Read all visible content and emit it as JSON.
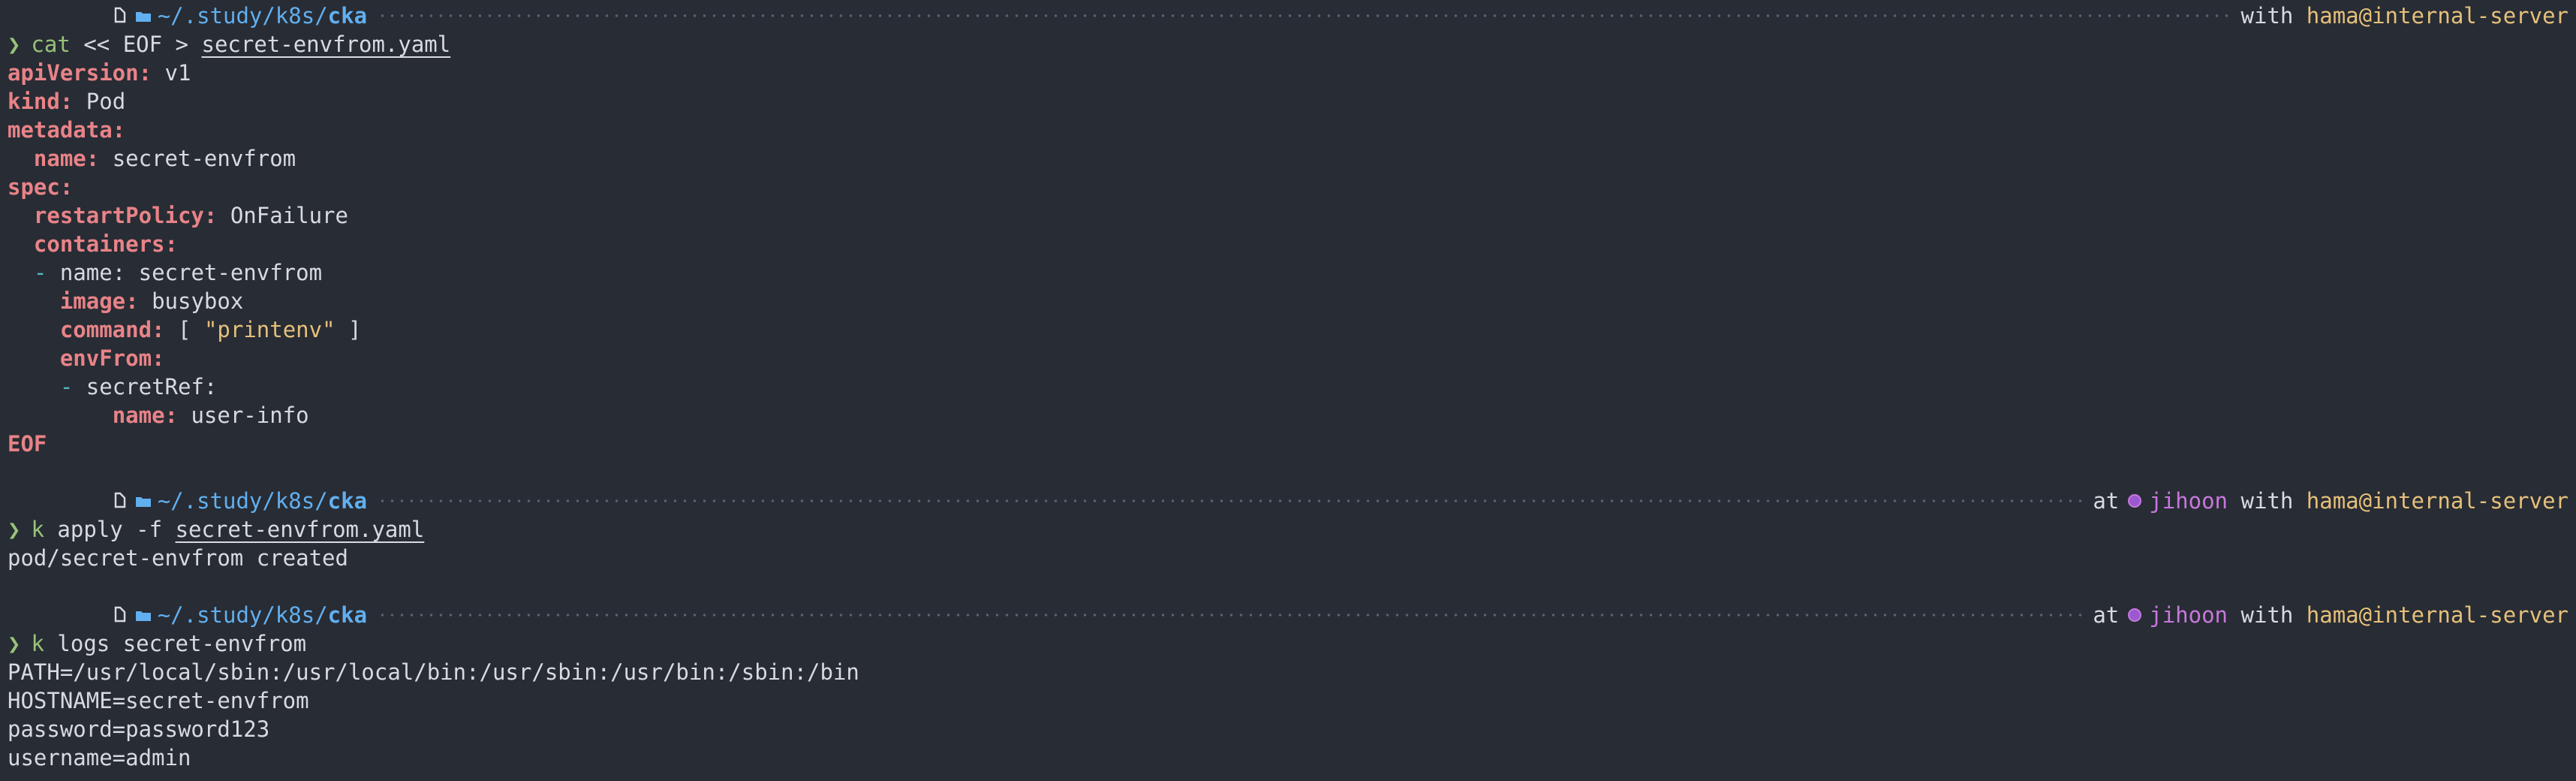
{
  "prompt": {
    "apple_icon": "apple-icon",
    "folder_icon": "folder-icon",
    "path_prefix": "~/.study/k8s/",
    "path_dir": "cka",
    "at_label": "at",
    "k8s_context": "jihoon",
    "with_label": "with",
    "user_host": "hama@internal-server",
    "chevron": "❯"
  },
  "block1": {
    "command_verb": "cat",
    "command_heredoc": "<< EOF >",
    "command_file": "secret-envfrom.yaml",
    "yaml": {
      "apiVersion_key": "apiVersion:",
      "apiVersion_val": "v1",
      "kind_key": "kind:",
      "kind_val": "Pod",
      "metadata_key": "metadata:",
      "name_key": "name:",
      "name_val": "secret-envfrom",
      "spec_key": "spec:",
      "restartPolicy_key": "restartPolicy:",
      "restartPolicy_val": "OnFailure",
      "containers_key": "containers:",
      "container_dash": "-",
      "container_name": "name: secret-envfrom",
      "image_key": "image:",
      "image_val": "busybox",
      "command_key": "command:",
      "command_open": "[",
      "command_str": "\"printenv\"",
      "command_close": "]",
      "envFrom_key": "envFrom:",
      "secretRef_dash": "-",
      "secretRef_label": "secretRef:",
      "secret_name_key": "name:",
      "secret_name_val": "user-info"
    },
    "eof": "EOF"
  },
  "block2": {
    "command_verb": "k",
    "command_args": "apply -f",
    "command_file": "secret-envfrom.yaml",
    "output": "pod/secret-envfrom created"
  },
  "block3": {
    "command_verb": "k",
    "command_args": "logs secret-envfrom",
    "output": [
      "PATH=/usr/local/sbin:/usr/local/bin:/usr/sbin:/usr/bin:/sbin:/bin",
      "HOSTNAME=secret-envfrom",
      "password=password123",
      "username=admin"
    ]
  }
}
